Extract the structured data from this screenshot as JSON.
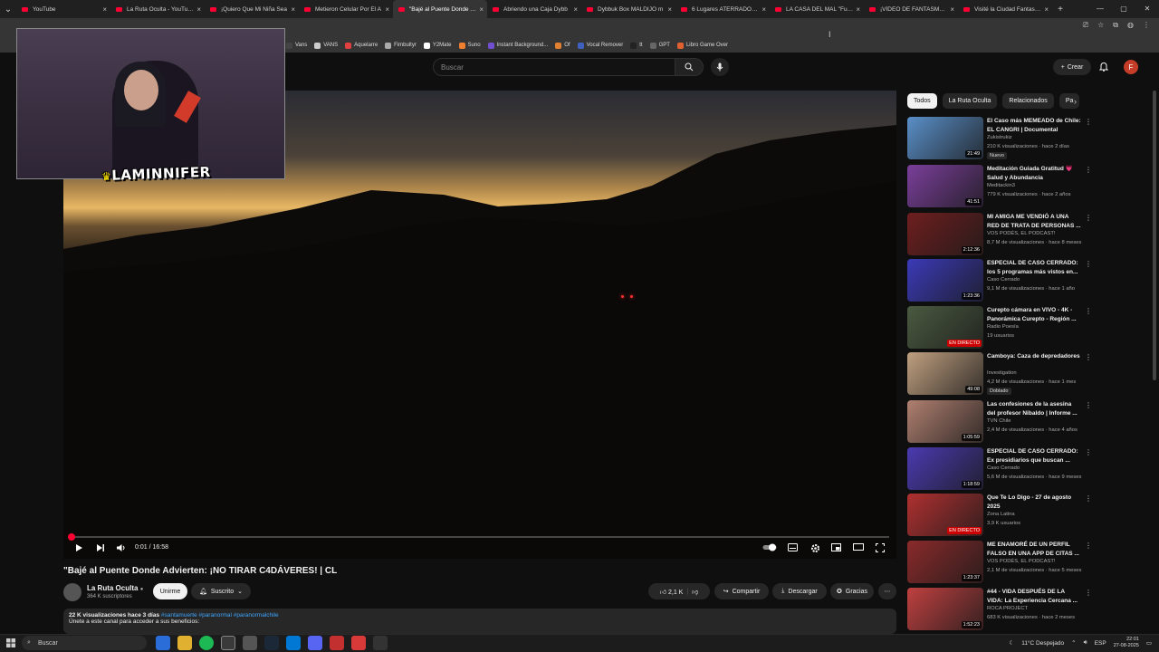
{
  "browser": {
    "tabs": [
      {
        "title": "YouTube",
        "active": false
      },
      {
        "title": "La Ruta Oculta - YouTube",
        "active": false
      },
      {
        "title": "¡Quiero Que Mi Niña Sea",
        "active": false
      },
      {
        "title": "Metieron Celular Por El A",
        "active": false
      },
      {
        "title": "\"Bajé al Puente Donde Ad",
        "active": true
      },
      {
        "title": "Abriendo una Caja Dybb",
        "active": false
      },
      {
        "title": "Dybbuk Box MALDIJO m",
        "active": false
      },
      {
        "title": "6 Lugares ATERRADORES",
        "active": false
      },
      {
        "title": "LA CASA DEL MAL \"Fue h",
        "active": false
      },
      {
        "title": "¡VÍDEO DE FANTASMAS A",
        "active": false
      },
      {
        "title": "Visité la Ciudad Fantasma",
        "active": false
      }
    ],
    "bookmarks": [
      "Vans",
      "VANS",
      "Aquelarre",
      "Fimbultyr",
      "Y2Mate",
      "Suno",
      "Instant Background...",
      "Of",
      "Vocal Remover",
      "tt",
      "GPT",
      "Libro Game Over"
    ]
  },
  "youtube": {
    "search_placeholder": "Buscar",
    "crear_label": "Crear",
    "avatar_letter": "F"
  },
  "webcam": {
    "streamer_logo": "LAMINNIFER"
  },
  "video": {
    "title": "\"Bajé al Puente Donde Advierten: ¡NO TIRAR C4DÁVERES! | CL",
    "timecode": "0:01 / 16:58",
    "progress_fraction": 0.001,
    "channel_name": "La Ruta Oculta",
    "channel_subs": "364 K suscriptores",
    "join_label": "Unirme",
    "subscribed_label": "Suscrito",
    "likes": "2,1 K",
    "share_label": "Compartir",
    "download_label": "Descargar",
    "thanks_label": "Gracias",
    "desc_meta": "22 K visualizaciones  hace 3 días",
    "desc_tags": "#santamuerte #paranormal #paranormalchile",
    "desc_line2": "Únete a este canal para acceder a sus beneficios:"
  },
  "sidebar": {
    "chips": [
      {
        "label": "Todos",
        "active": true
      },
      {
        "label": "La Ruta Oculta",
        "active": false
      },
      {
        "label": "Relacionados",
        "active": false
      },
      {
        "label": "Pa",
        "active": false
      }
    ],
    "recs": [
      {
        "title": "El Caso más MEMEADO de Chile: EL CANGRI | Documental",
        "channel": "Zukistrukiz",
        "views": "210 K visualizaciones · hace 2 días",
        "badge": "Nuevo",
        "duration": "21:49",
        "live": false,
        "color": "#5a8fc8"
      },
      {
        "title": "Meditación Guiada Gratitud 💗 Salud y Abundancia",
        "channel": "Meditackin3",
        "views": "779 K visualizaciones · hace 2 años",
        "badge": "",
        "duration": "41:51",
        "live": false,
        "color": "#7a3f9a"
      },
      {
        "title": "MI AMIGA ME VENDIÓ A UNA RED DE TRATA DE PERSONAS ...",
        "channel": "VOS PODÉS, EL PODCAST!",
        "views": "8,7 M de visualizaciones · hace 8 meses",
        "badge": "",
        "duration": "2:12:36",
        "live": false,
        "color": "#6e1e1e"
      },
      {
        "title": "ESPECIAL DE CASO CERRADO: los 5 programas más vistos en...",
        "channel": "Caso Cerrado",
        "views": "9,1 M de visualizaciones · hace 1 año",
        "badge": "",
        "duration": "1:23:36",
        "live": false,
        "color": "#3b3ab8"
      },
      {
        "title": "Curepto cámara en VIVO - 4K - Panorámica Curepto - Región ...",
        "channel": "Radio Poesía",
        "views": "19 usuarios",
        "badge": "",
        "duration": "EN DIRECTO",
        "live": true,
        "color": "#4a5a40"
      },
      {
        "title": "Camboya: Caza de depredadores",
        "channel": "Investigation",
        "views": "4,2 M de visualizaciones · hace 1 mes",
        "badge": "Doblado",
        "duration": "49:08",
        "live": false,
        "color": "#c0a080"
      },
      {
        "title": "Las confesiones de la asesina del profesor Nibaldo | Informe ...",
        "channel": "TVN Chile",
        "views": "2,4 M de visualizaciones · hace 4 años",
        "badge": "",
        "duration": "1:05:59",
        "live": false,
        "color": "#b08070"
      },
      {
        "title": "ESPECIAL DE CASO CERRADO: Ex presidiarios que buscan ...",
        "channel": "Caso Cerrado",
        "views": "5,6 M de visualizaciones · hace 9 meses",
        "badge": "",
        "duration": "1:18:59",
        "live": false,
        "color": "#4a3ab0"
      },
      {
        "title": "Que Te Lo Digo - 27 de agosto 2025",
        "channel": "Zona Latina",
        "views": "3,9 K usuarios",
        "badge": "",
        "duration": "EN DIRECTO",
        "live": true,
        "color": "#b03030"
      },
      {
        "title": "ME ENAMORÉ DE UN PERFIL FALSO EN UNA APP DE CITAS ...",
        "channel": "VOS PODÉS, EL PODCAST!",
        "views": "2,1 M de visualizaciones · hace 5 meses",
        "badge": "",
        "duration": "1:23:37",
        "live": false,
        "color": "#8a2a2a"
      },
      {
        "title": "#44 - VIDA DESPUÉS DE LA VIDA: La Experiencia Cercana ...",
        "channel": "ROCA PROJECT",
        "views": "683 K visualizaciones · hace 2 meses",
        "badge": "",
        "duration": "1:52:23",
        "live": false,
        "color": "#c04040"
      }
    ]
  },
  "taskbar": {
    "search_label": "Buscar",
    "weather": "11°C  Despejado",
    "lang": "ESP",
    "time": "22:01",
    "date": "27-08-2025"
  }
}
